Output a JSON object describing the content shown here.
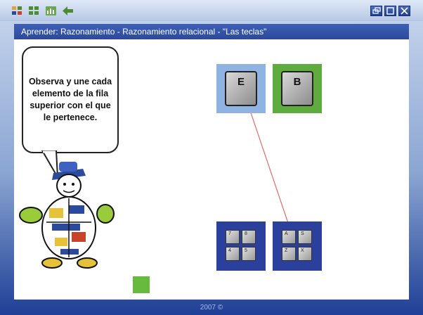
{
  "window": {
    "title": "Aprender: Razonamiento - Razonamiento relacional - \"Las teclas\"",
    "footer": "2007 ©"
  },
  "toolbar": [
    "grid-icon",
    "apps-icon",
    "chart-icon",
    "back-arrow-icon"
  ],
  "window_controls": [
    "restore-icon",
    "maximize-icon",
    "close-icon"
  ],
  "instruction": "Observa y une cada elemento de la fila superior con el que le pertenece.",
  "top_keys": [
    {
      "label": "E",
      "bg": "#8fb4e3"
    },
    {
      "label": "B",
      "bg": "#5fac3e"
    }
  ],
  "bottom_keys": [
    {
      "labels": [
        "7",
        "8",
        "4",
        "5"
      ],
      "bg": "#2b3f9c"
    },
    {
      "labels": [
        "A",
        "S",
        "Z",
        "X"
      ],
      "bg": "#2b3f9c"
    }
  ],
  "connection": {
    "from": "E",
    "to": "A"
  },
  "colors": {
    "accent_blue": "#2b4a9c",
    "green": "#5fac3e",
    "line": "#e36b6b"
  }
}
